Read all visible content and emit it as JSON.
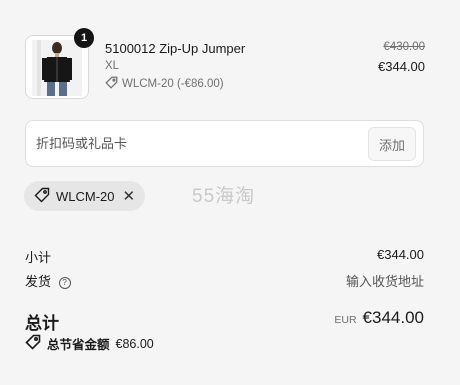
{
  "product": {
    "quantity": "1",
    "title": "5100012 Zip-Up Jumper",
    "variant": "XL",
    "discount_line": "WLCM-20 (-€86.00)",
    "original_price": "€430.00",
    "price": "€344.00"
  },
  "discount_input": {
    "placeholder": "折扣码或礼品卡",
    "apply_label": "添加"
  },
  "applied_code": {
    "label": "WLCM-20"
  },
  "watermark": "55海淘",
  "summary": {
    "subtotal_label": "小计",
    "subtotal_value": "€344.00",
    "shipping_label": "发货",
    "shipping_value": "输入收货地址",
    "total_label": "总计",
    "currency": "EUR",
    "total_value": "€344.00",
    "savings_label": "总节省金额",
    "savings_value": "€86.00"
  },
  "colors": {
    "accent": "#141414",
    "muted": "#707070",
    "background": "#f5f5f5"
  }
}
